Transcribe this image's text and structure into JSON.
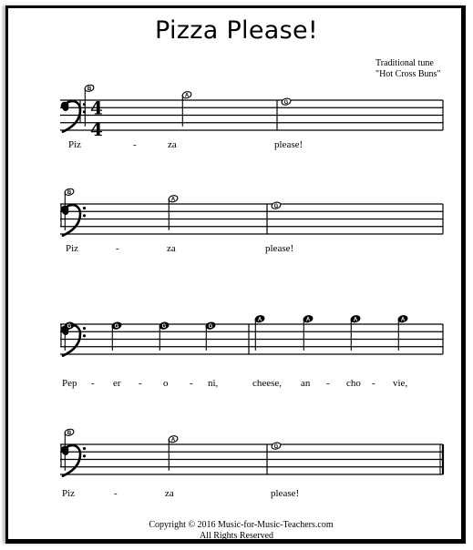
{
  "sheet": {
    "title": "Pizza Please!",
    "attribution": {
      "line1": "Traditional tune",
      "line2": "\"Hot Cross Buns\""
    },
    "clef": "bass",
    "time_signature": {
      "top": "4",
      "bottom": "4"
    },
    "systems": [
      {
        "measures": [
          {
            "notes": [
              {
                "letter": "B",
                "duration": "half"
              },
              {
                "letter": "A",
                "duration": "half"
              }
            ]
          },
          {
            "notes": [
              {
                "letter": "G",
                "duration": "whole"
              }
            ]
          }
        ],
        "lyrics": [
          "Piz",
          "-",
          "za",
          "please!"
        ],
        "show_time_signature": true,
        "end_barline": "single"
      },
      {
        "measures": [
          {
            "notes": [
              {
                "letter": "B",
                "duration": "half"
              },
              {
                "letter": "A",
                "duration": "half"
              }
            ]
          },
          {
            "notes": [
              {
                "letter": "G",
                "duration": "whole"
              }
            ]
          }
        ],
        "lyrics": [
          "Piz",
          "-",
          "za",
          "please!"
        ],
        "show_time_signature": false,
        "end_barline": "single"
      },
      {
        "measures": [
          {
            "notes": [
              {
                "letter": "G",
                "duration": "quarter"
              },
              {
                "letter": "G",
                "duration": "quarter"
              },
              {
                "letter": "G",
                "duration": "quarter"
              },
              {
                "letter": "G",
                "duration": "quarter"
              }
            ]
          },
          {
            "notes": [
              {
                "letter": "A",
                "duration": "quarter"
              },
              {
                "letter": "A",
                "duration": "quarter"
              },
              {
                "letter": "A",
                "duration": "quarter"
              },
              {
                "letter": "A",
                "duration": "quarter"
              }
            ]
          }
        ],
        "lyrics": [
          "Pep",
          "-",
          "er",
          "-",
          "o",
          "-",
          "ni,",
          "cheese,",
          "an",
          "-",
          "cho",
          "-",
          "vie,"
        ],
        "show_time_signature": false,
        "end_barline": "single"
      },
      {
        "measures": [
          {
            "notes": [
              {
                "letter": "B",
                "duration": "half"
              },
              {
                "letter": "A",
                "duration": "half"
              }
            ]
          },
          {
            "notes": [
              {
                "letter": "G",
                "duration": "whole"
              }
            ]
          }
        ],
        "lyrics": [
          "Piz",
          "-",
          "za",
          "please!"
        ],
        "show_time_signature": false,
        "end_barline": "final"
      }
    ],
    "footer": {
      "copyright": "Copyright © 2016  Music-for-Music-Teachers.com",
      "rights": "All Rights Reserved"
    }
  }
}
